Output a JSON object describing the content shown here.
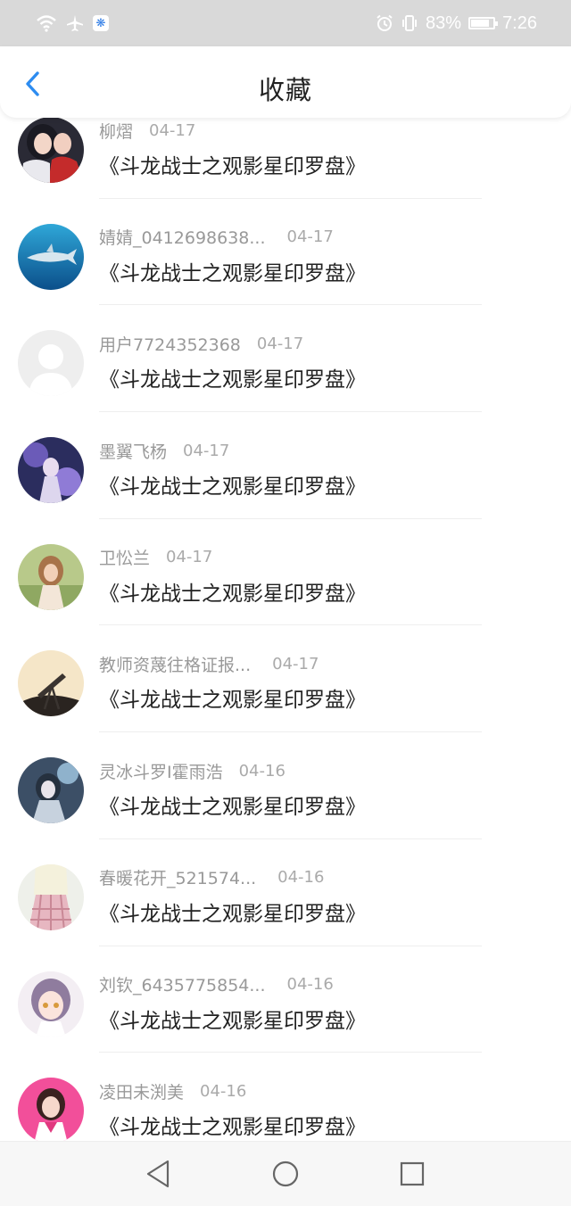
{
  "status_bar": {
    "wifi_icon": "wifi-icon",
    "airplane_icon": "airplane-icon",
    "app_icon": "baidu-paw-icon",
    "alarm_icon": "alarm-icon",
    "vibrate_icon": "vibrate-icon",
    "battery_percent": "83%",
    "battery_level": 0.83,
    "time": "7:26"
  },
  "header": {
    "title": "收藏",
    "back_icon": "chevron-left-icon",
    "accent": "#2d8cf0"
  },
  "favorites": [
    {
      "user": "柳熠",
      "date": "04-17",
      "content": "《斗龙战士之观影星印罗盘》",
      "avatar": "avatar-dark-anime"
    },
    {
      "user": "婧婧_0412698638...",
      "date": "04-17",
      "content": "《斗龙战士之观影星印罗盘》",
      "avatar": "avatar-shark-ocean"
    },
    {
      "user": "用户7724352368",
      "date": "04-17",
      "content": "《斗龙战士之观影星印罗盘》",
      "avatar": "avatar-default-person"
    },
    {
      "user": "墨翼飞杨",
      "date": "04-17",
      "content": "《斗龙战士之观影星印罗盘》",
      "avatar": "avatar-purple-anime"
    },
    {
      "user": "卫忪兰",
      "date": "04-17",
      "content": "《斗龙战士之观影星印罗盘》",
      "avatar": "avatar-girl-field"
    },
    {
      "user": "教师资蔑往格证报...",
      "date": "04-17",
      "content": "《斗龙战士之观影星印罗盘》",
      "avatar": "avatar-telescope"
    },
    {
      "user": "灵冰斗罗I霍雨浩",
      "date": "04-16",
      "content": "《斗龙战士之观影星印罗盘》",
      "avatar": "avatar-blue-anime"
    },
    {
      "user": "春暖花开_521574...",
      "date": "04-16",
      "content": "《斗龙战士之观影星印罗盘》",
      "avatar": "avatar-plaid-skirt"
    },
    {
      "user": "刘钦_6435775854...",
      "date": "04-16",
      "content": "《斗龙战士之观影星印罗盘》",
      "avatar": "avatar-anime-girl"
    },
    {
      "user": "凌田未渕美",
      "date": "04-16",
      "content": "《斗龙战士之观影星印罗盘》",
      "avatar": "avatar-pink-girl"
    }
  ],
  "nav_bar": {
    "back_icon": "triangle-back-icon",
    "home_icon": "circle-home-icon",
    "recent_icon": "square-recent-icon"
  }
}
